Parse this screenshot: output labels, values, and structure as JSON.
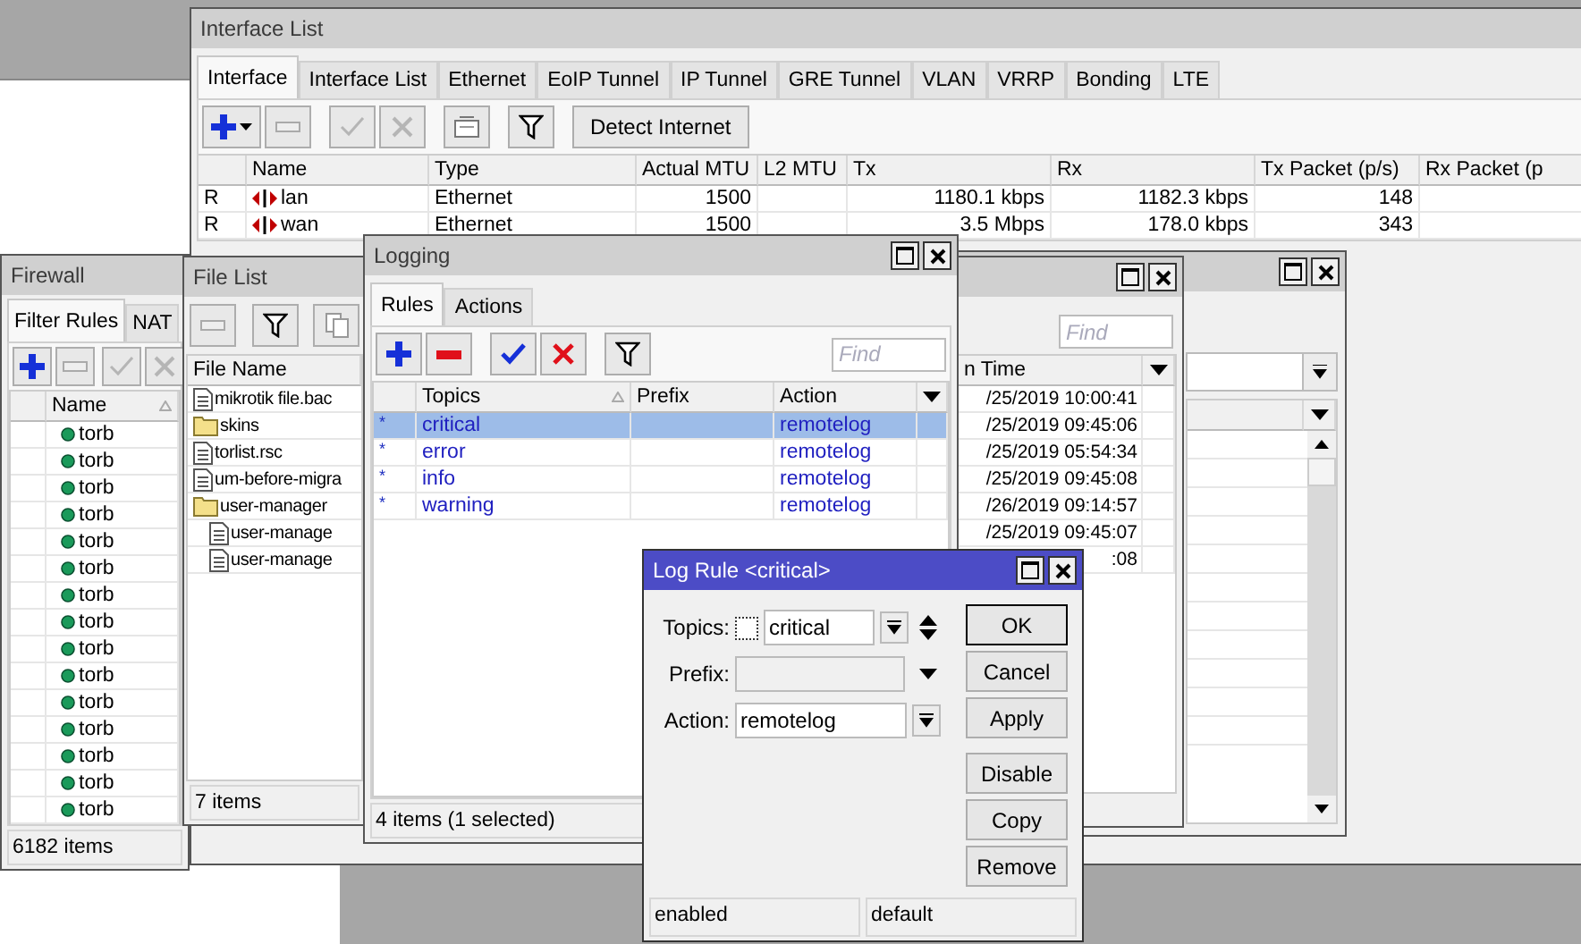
{
  "interface_window": {
    "title": "Interface List",
    "tabs": [
      {
        "label": "Interface",
        "selected": true
      },
      {
        "label": "Interface List",
        "selected": false
      },
      {
        "label": "Ethernet",
        "selected": false
      },
      {
        "label": "EoIP Tunnel",
        "selected": false
      },
      {
        "label": "IP Tunnel",
        "selected": false
      },
      {
        "label": "GRE Tunnel",
        "selected": false
      },
      {
        "label": "VLAN",
        "selected": false
      },
      {
        "label": "VRRP",
        "selected": false
      },
      {
        "label": "Bonding",
        "selected": false
      },
      {
        "label": "LTE",
        "selected": false
      }
    ],
    "detect_button": "Detect Internet",
    "columns": [
      "Name",
      "Type",
      "Actual MTU",
      "L2 MTU",
      "Tx",
      "Rx",
      "Tx Packet (p/s)",
      "Rx Packet (p"
    ],
    "rows": [
      {
        "flag": "R",
        "name": "lan",
        "type": "Ethernet",
        "actual_mtu": "1500",
        "tx": "1180.1 kbps",
        "rx": "1182.3 kbps",
        "tx_packet": "148"
      },
      {
        "flag": "R",
        "name": "wan",
        "type": "Ethernet",
        "actual_mtu": "1500",
        "tx": "3.5 Mbps",
        "rx": "178.0 kbps",
        "tx_packet": "343"
      }
    ]
  },
  "firewall_window": {
    "title": "Firewall",
    "tabs": [
      {
        "label": "Filter Rules",
        "selected": true
      },
      {
        "label": "NAT",
        "selected": false
      }
    ],
    "columns": [
      "Name"
    ],
    "rows": [
      "torb",
      "torb",
      "torb",
      "torb",
      "torb",
      "torb",
      "torb",
      "torb",
      "torb",
      "torb",
      "torb",
      "torb",
      "torb",
      "torb",
      "torb"
    ],
    "status": "6182 items"
  },
  "file_list_window": {
    "title": "File List",
    "columns": [
      "File Name"
    ],
    "rows": [
      {
        "name": "mikrotik file.bac",
        "kind": "file"
      },
      {
        "name": "skins",
        "kind": "folder"
      },
      {
        "name": "torlist.rsc",
        "kind": "file"
      },
      {
        "name": "um-before-migra",
        "kind": "file"
      },
      {
        "name": "user-manager",
        "kind": "folder",
        "children": [
          {
            "name": "user-manage",
            "kind": "file"
          },
          {
            "name": "user-manage",
            "kind": "file"
          }
        ]
      }
    ],
    "status": "7 items"
  },
  "time_window": {
    "find_placeholder": "Find",
    "columns": [
      "n Time"
    ],
    "rows": [
      "/25/2019 10:00:41",
      "/25/2019 09:45:06",
      "/25/2019 05:54:34",
      "/25/2019 09:45:08",
      "/26/2019 09:14:57",
      "/25/2019 09:45:07",
      ":08"
    ]
  },
  "logging_window": {
    "title": "Logging",
    "tabs": [
      {
        "label": "Rules",
        "selected": true
      },
      {
        "label": "Actions",
        "selected": false
      }
    ],
    "find_placeholder": "Find",
    "columns": [
      "Topics",
      "Prefix",
      "Action"
    ],
    "rows": [
      {
        "flag": "*",
        "topics": "critical",
        "action": "remotelog",
        "selected": true
      },
      {
        "flag": "*",
        "topics": "error",
        "action": "remotelog",
        "selected": false
      },
      {
        "flag": "*",
        "topics": "info",
        "action": "remotelog",
        "selected": false
      },
      {
        "flag": "*",
        "topics": "warning",
        "action": "remotelog",
        "selected": false
      }
    ],
    "status": "4 items (1 selected)"
  },
  "log_rule_dialog": {
    "title": "Log Rule <critical>",
    "fields": [
      {
        "label": "Topics:",
        "kind": "multi",
        "value": "critical",
        "negate_checked": false,
        "disabled": false
      },
      {
        "label": "Prefix:",
        "kind": "text",
        "disabled": true
      },
      {
        "label": "Action:",
        "kind": "select",
        "value": "remotelog",
        "disabled": false
      }
    ],
    "button_groups": [
      [
        {
          "label": "OK",
          "default": true
        },
        {
          "label": "Cancel",
          "default": false
        },
        {
          "label": "Apply",
          "default": false
        }
      ],
      [
        {
          "label": "Disable",
          "default": false
        },
        {
          "label": "Copy",
          "default": false
        },
        {
          "label": "Remove",
          "default": false
        }
      ]
    ],
    "status": [
      "enabled",
      "default"
    ]
  }
}
